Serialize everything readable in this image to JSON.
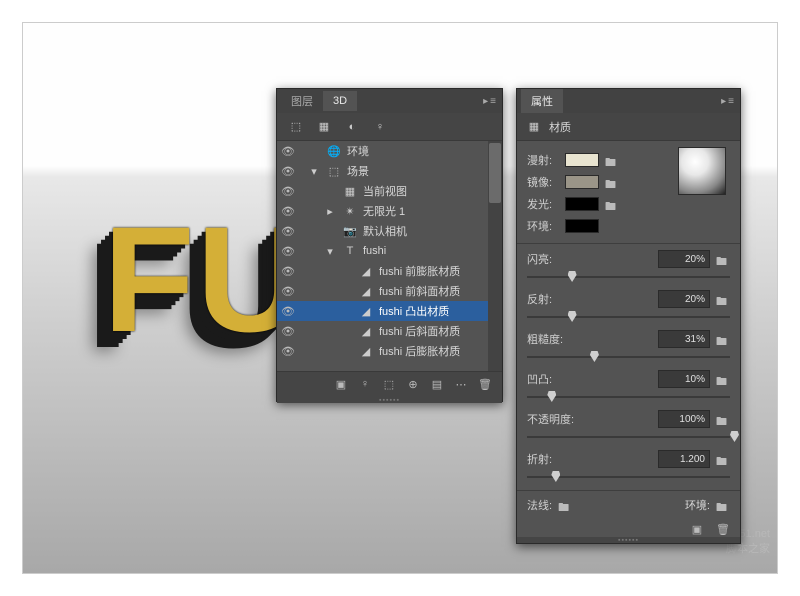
{
  "panel3d": {
    "tabs": {
      "layers": "图层",
      "d3": "3D"
    },
    "tree": [
      {
        "icon": "globe",
        "label": "环境",
        "indent": 0,
        "arrow": ""
      },
      {
        "icon": "scene",
        "label": "场景",
        "indent": 0,
        "arrow": "▾"
      },
      {
        "icon": "view",
        "label": "当前视图",
        "indent": 1,
        "arrow": ""
      },
      {
        "icon": "light",
        "label": "无限光 1",
        "indent": 1,
        "arrow": "▸"
      },
      {
        "icon": "camera",
        "label": "默认相机",
        "indent": 1,
        "arrow": ""
      },
      {
        "icon": "mesh",
        "label": "fushi",
        "indent": 1,
        "arrow": "▾"
      },
      {
        "icon": "mat",
        "label": "fushi 前膨胀材质",
        "indent": 2,
        "arrow": ""
      },
      {
        "icon": "mat",
        "label": "fushi 前斜面材质",
        "indent": 2,
        "arrow": ""
      },
      {
        "icon": "mat",
        "label": "fushi 凸出材质",
        "indent": 2,
        "arrow": "",
        "selected": true
      },
      {
        "icon": "mat",
        "label": "fushi 后斜面材质",
        "indent": 2,
        "arrow": ""
      },
      {
        "icon": "mat",
        "label": "fushi 后膨胀材质",
        "indent": 2,
        "arrow": ""
      }
    ]
  },
  "panelProp": {
    "tab": "属性",
    "subtitle": "材质",
    "rows": {
      "diffuse": {
        "label": "漫射:",
        "color": "#e8e4d0"
      },
      "specular": {
        "label": "镜像:",
        "color": "#9a9588"
      },
      "illum": {
        "label": "发光:",
        "color": "#000000"
      },
      "ambient": {
        "label": "环境:",
        "color": "#000000"
      }
    },
    "sliders": {
      "shine": {
        "label": "闪亮:",
        "value": "20%",
        "pos": 20
      },
      "reflect": {
        "label": "反射:",
        "value": "20%",
        "pos": 20
      },
      "rough": {
        "label": "粗糙度:",
        "value": "31%",
        "pos": 31
      },
      "bump": {
        "label": "凹凸:",
        "value": "10%",
        "pos": 10
      },
      "opacity": {
        "label": "不透明度:",
        "value": "100%",
        "pos": 100
      },
      "refract": {
        "label": "折射:",
        "value": "1.200",
        "pos": 12
      }
    },
    "normals": "法线:",
    "env": "环境:"
  },
  "viewport": {
    "text": "FU"
  },
  "watermark": {
    "l1": "jb51.net",
    "l2": "脚本之家"
  }
}
